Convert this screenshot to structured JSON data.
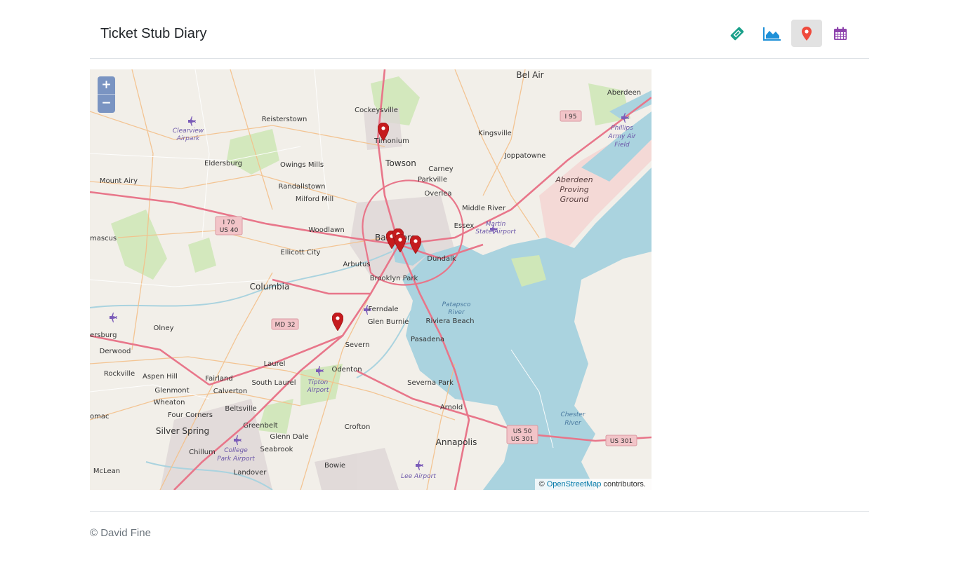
{
  "app": {
    "title": "Ticket Stub Diary"
  },
  "nav": {
    "items": [
      {
        "name": "tickets",
        "icon": "ticket-icon",
        "color": "#1aa08a",
        "active": false
      },
      {
        "name": "stats",
        "icon": "area-chart-icon",
        "color": "#1e90d8",
        "active": false
      },
      {
        "name": "map",
        "icon": "map-marker-icon",
        "color": "#ef4a3c",
        "active": true
      },
      {
        "name": "calendar",
        "icon": "calendar-icon",
        "color": "#8e44ad",
        "active": false
      }
    ]
  },
  "map": {
    "zoom_in_label": "+",
    "zoom_out_label": "−",
    "attribution": {
      "prefix": "© ",
      "link_text": "OpenStreetMap",
      "suffix": " contributors."
    },
    "marker_color": "#c51b1e",
    "place_labels": {
      "bel_air": "Bel Air",
      "aberdeen": "Aberdeen",
      "cockeysville": "Cockeysville",
      "reisterstown": "Reisterstown",
      "timonium": "Timonium",
      "kingsville": "Kingsville",
      "clearview": "Clearview",
      "airpark": "Airpark",
      "phillips": "Phillips",
      "army_air": "Army Air",
      "field": "Field",
      "joppatowne": "Joppatowne",
      "eldersburg": "Eldersburg",
      "owings_mills": "Owings Mills",
      "towson": "Towson",
      "carney": "Carney",
      "aberdeen_proving": "Aberdeen",
      "proving": "Proving",
      "ground": "Ground",
      "mount_airy": "Mount Airy",
      "randallstown": "Randallstown",
      "parkville": "Parkville",
      "overlea": "Overlea",
      "milford_mill": "Milford Mill",
      "middle_river": "Middle River",
      "martin": "Martin",
      "state_airport": "State Airport",
      "essex": "Essex",
      "woodlawn": "Woodlawn",
      "damascus": "mascus",
      "baltimore": "Baltimore",
      "ellicott_city": "Ellicott City",
      "dundalk": "Dundalk",
      "arbutus": "Arbutus",
      "columbia": "Columbia",
      "brooklyn_park": "Brooklyn Park",
      "patapsco": "Patapsco",
      "river": "River",
      "ferndale": "Ferndale",
      "glen_burnie": "Glen Burnie",
      "riviera_beach": "Riviera Beach",
      "olney": "Olney",
      "gaithersburg": "ersburg",
      "derwood": "Derwood",
      "severn": "Severn",
      "pasadena": "Pasadena",
      "laurel": "Laurel",
      "odenton": "Odenton",
      "rockville": "Rockville",
      "aspen_hill": "Aspen Hill",
      "fairland": "Fairland",
      "south_laurel": "South Laurel",
      "tipton": "Tipton",
      "airport": "Airport",
      "severna_park": "Severna Park",
      "glenmont": "Glenmont",
      "calverton": "Calverton",
      "wheaton": "Wheaton",
      "beltsville": "Beltsville",
      "arnold": "Arnold",
      "potomac": "omac",
      "four_corners": "Four Corners",
      "chester": "Chester",
      "chester_river": "River",
      "greenbelt": "Greenbelt",
      "crofton": "Crofton",
      "silver_spring": "Silver Spring",
      "glenn_dale": "Glenn Dale",
      "annapolis": "Annapolis",
      "chillum": "Chillum",
      "seabrook": "Seabrook",
      "college": "College",
      "park_airport": "Park Airport",
      "bowie": "Bowie",
      "mclean": "McLean",
      "landover": "Landover",
      "lee_airport": "Lee Airport"
    },
    "shields": {
      "i95": "I 95",
      "i70": "I 70",
      "us40": "US 40",
      "md32": "MD 32",
      "us50": "US 50",
      "us301a": "US 301",
      "us301b": "US 301"
    }
  },
  "footer": {
    "text": "© David Fine"
  }
}
